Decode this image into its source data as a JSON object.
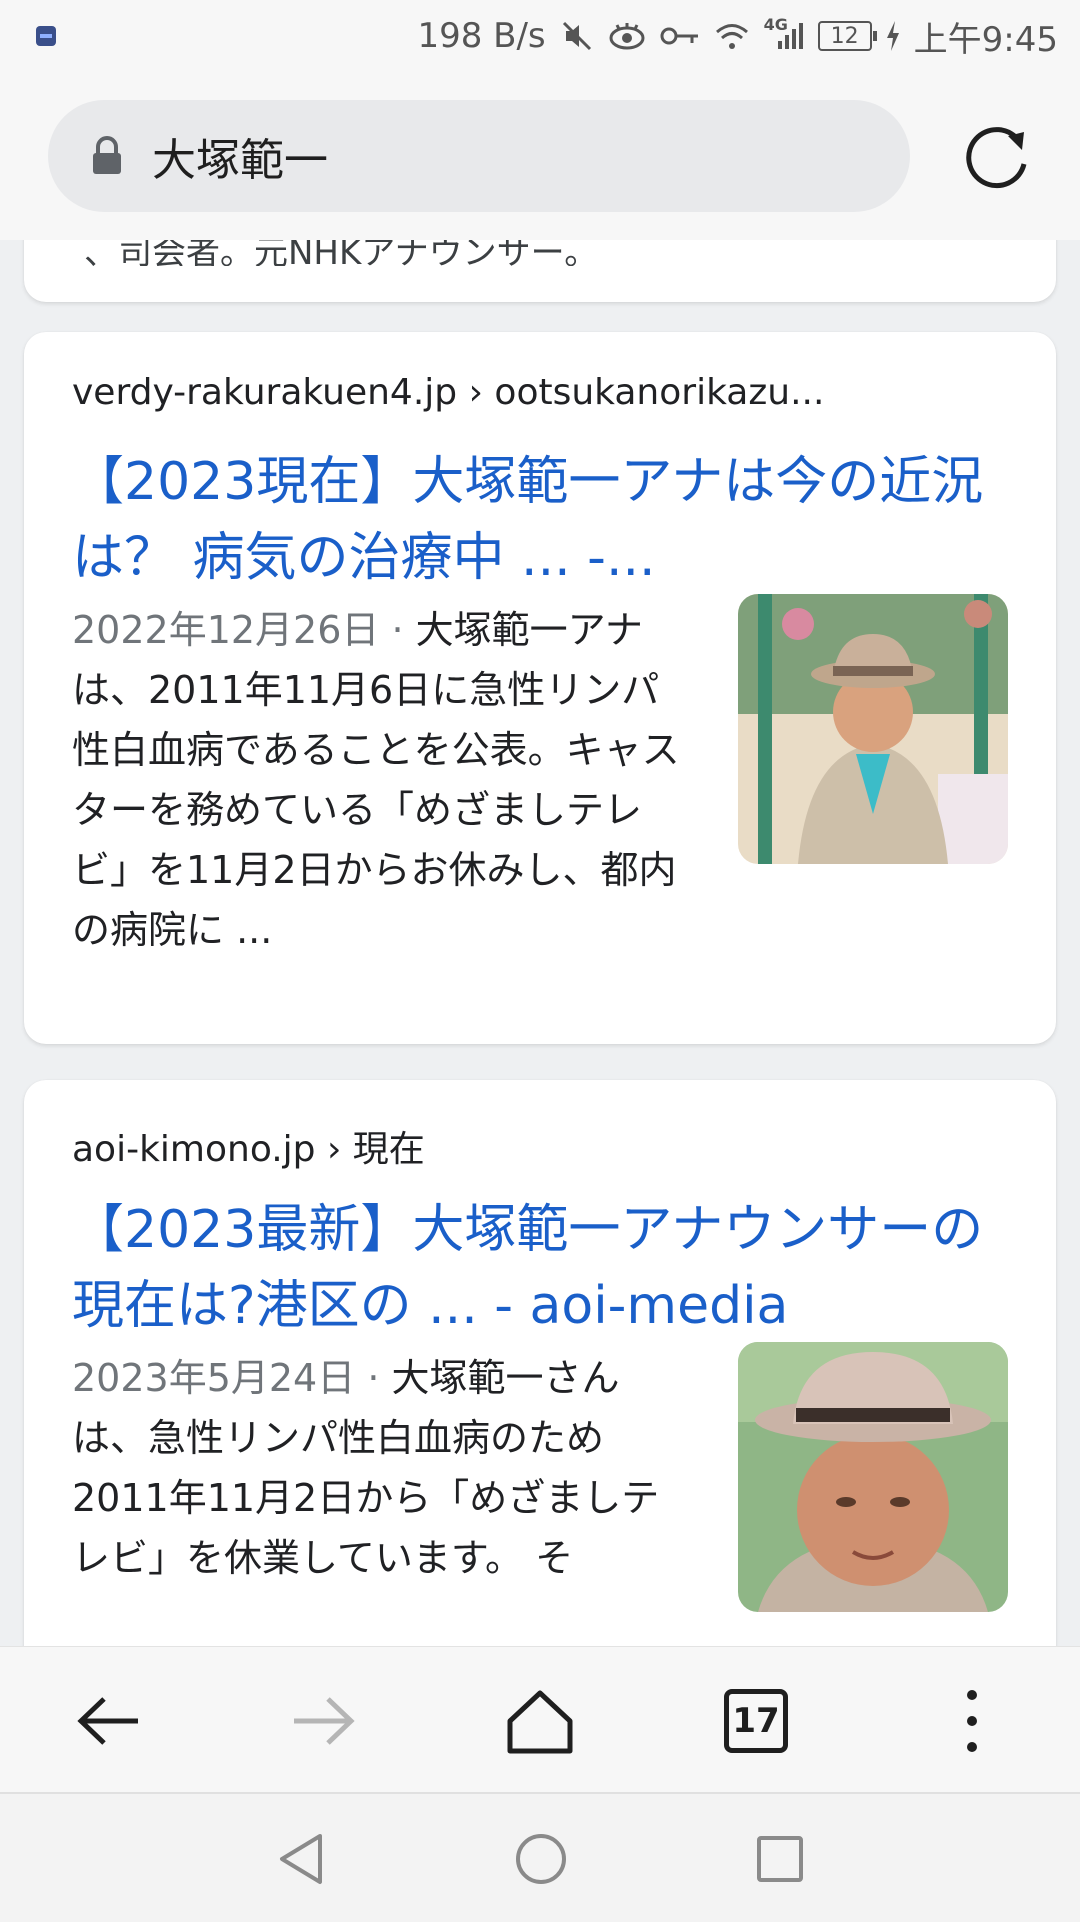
{
  "status_bar": {
    "net_speed": "198 B/s",
    "network": "4G",
    "battery": "12",
    "time": "上午9:45"
  },
  "url_bar": {
    "text": "大塚範一"
  },
  "previous_result": {
    "snippet_tail": "、司会者。元NHKアナウンサー。"
  },
  "results": [
    {
      "breadcrumb": "verdy-rakurakuen4.jp › ootsukanorikazu...",
      "title": "【2023現在】大塚範一アナは今の近況は？ 病気の治療中 ... -...",
      "date": "2022年12月26日",
      "separator": " · ",
      "snippet": "大塚範一アナは、2011年11月6日に急性リンパ性白血病であることを公表。キャスターを務めている「めざましテレビ」を11月2日からお休みし、都内の病院に ..."
    },
    {
      "breadcrumb": "aoi-kimono.jp › 現在",
      "title": "【2023最新】大塚範一アナウンサーの現在は?港区の ... - aoi-media",
      "date": "2023年5月24日",
      "separator": " · ",
      "snippet": "大塚範一さんは、急性リンパ性白血病のため2011年11月2日から「めざましテレビ」を休業しています。 そ"
    }
  ],
  "toolbar": {
    "tab_count": "17"
  },
  "colors": {
    "link": "#1a5fc9",
    "date": "#70757a",
    "background": "#eef0f2"
  }
}
